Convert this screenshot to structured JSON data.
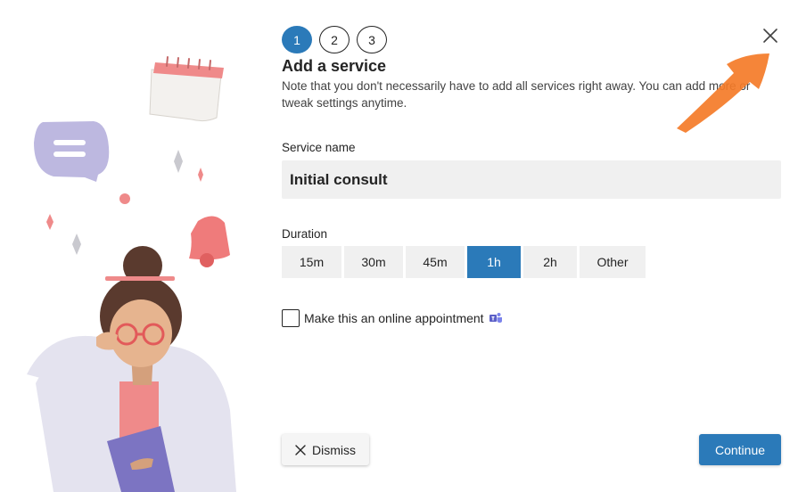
{
  "steps": [
    {
      "label": "1",
      "active": true
    },
    {
      "label": "2",
      "active": false
    },
    {
      "label": "3",
      "active": false
    }
  ],
  "header": {
    "title": "Add a service",
    "note": "Note that you don't necessarily have to add all services right away. You can add more or tweak settings anytime."
  },
  "service": {
    "label": "Service name",
    "value": "Initial consult"
  },
  "duration": {
    "label": "Duration",
    "options": [
      "15m",
      "30m",
      "45m",
      "1h",
      "2h",
      "Other"
    ],
    "selected": "1h"
  },
  "online": {
    "label": "Make this an online appointment",
    "checked": false
  },
  "footer": {
    "dismiss_label": "Dismiss",
    "continue_label": "Continue"
  },
  "colors": {
    "accent": "#2b7ab9",
    "arrow": "#f47b28",
    "field_bg": "#f0f0f0"
  }
}
